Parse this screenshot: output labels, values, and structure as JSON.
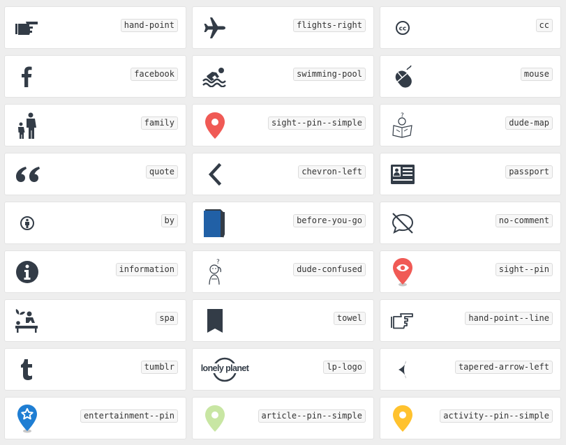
{
  "colors": {
    "icon_dark": "#333c47",
    "pin_red": "#f05a55",
    "pin_blue": "#1f7ed3",
    "pin_green": "#c8e6a3",
    "pin_yellow": "#ffc22e",
    "folder_blue": "#2160a6"
  },
  "icons": [
    {
      "name": "hand-point",
      "icon": "hand-point-icon"
    },
    {
      "name": "flights-right",
      "icon": "airplane-icon"
    },
    {
      "name": "cc",
      "icon": "creative-commons-icon"
    },
    {
      "name": "facebook",
      "icon": "facebook-icon"
    },
    {
      "name": "swimming-pool",
      "icon": "swimmer-icon"
    },
    {
      "name": "mouse",
      "icon": "computer-mouse-icon"
    },
    {
      "name": "family",
      "icon": "family-icon"
    },
    {
      "name": "sight--pin--simple",
      "icon": "red-map-pin-icon"
    },
    {
      "name": "dude-map",
      "icon": "dude-reading-map-icon"
    },
    {
      "name": "quote",
      "icon": "quote-icon"
    },
    {
      "name": "chevron-left",
      "icon": "chevron-left-icon"
    },
    {
      "name": "passport",
      "icon": "passport-icon"
    },
    {
      "name": "by",
      "icon": "attribution-person-icon"
    },
    {
      "name": "before-you-go",
      "icon": "blue-folder-icon"
    },
    {
      "name": "no-comment",
      "icon": "no-comment-icon"
    },
    {
      "name": "information",
      "icon": "information-icon"
    },
    {
      "name": "dude-confused",
      "icon": "confused-dude-icon"
    },
    {
      "name": "sight--pin",
      "icon": "eye-map-pin-icon"
    },
    {
      "name": "spa",
      "icon": "spa-massage-icon"
    },
    {
      "name": "towel",
      "icon": "towel-icon"
    },
    {
      "name": "hand-point--line",
      "icon": "hand-point-outline-icon"
    },
    {
      "name": "tumblr",
      "icon": "tumblr-icon"
    },
    {
      "name": "lp-logo",
      "icon": "lonely-planet-logo-icon",
      "logo_text": "lonely planet"
    },
    {
      "name": "tapered-arrow-left",
      "icon": "tapered-arrow-left-icon"
    },
    {
      "name": "entertainment--pin",
      "icon": "star-map-pin-icon"
    },
    {
      "name": "article--pin--simple",
      "icon": "green-map-pin-icon"
    },
    {
      "name": "activity--pin--simple",
      "icon": "yellow-map-pin-icon"
    }
  ]
}
